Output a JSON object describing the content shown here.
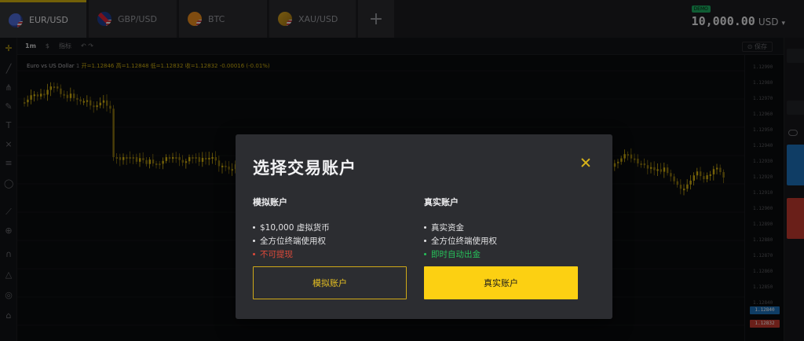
{
  "tabs": [
    {
      "label": "EUR/USD",
      "icon": "eur-usd-flag-icon",
      "active": true
    },
    {
      "label": "GBP/USD",
      "icon": "gbp-usd-flag-icon",
      "active": false
    },
    {
      "label": "BTC",
      "icon": "btc-icon",
      "active": false
    },
    {
      "label": "XAU/USD",
      "icon": "gold-icon",
      "active": false
    }
  ],
  "add_tab_label": "+",
  "account": {
    "badge": "DEMO",
    "amount": "10,000.00",
    "currency": "USD",
    "caret": "▾"
  },
  "toolbar": {
    "timeframe": "1m",
    "chart_type": "$",
    "indicators": "指标",
    "undo": "↶ ↷",
    "right_btn": "⊙ 保存"
  },
  "ohlc": {
    "pair": "Euro vs US Dollar",
    "interval": "1",
    "values": "开=1.12846 高=1.12848 低=1.12832 收=1.12832 -0.00016 (-0.01%)"
  },
  "price_axis": {
    "ticks": [
      "1.12990",
      "1.12980",
      "1.12970",
      "1.12960",
      "1.12950",
      "1.12940",
      "1.12930",
      "1.12920",
      "1.12910",
      "1.12900",
      "1.12890",
      "1.12880",
      "1.12870",
      "1.12860",
      "1.12850",
      "1.12840"
    ],
    "tag_blue": "1.12840",
    "tag_red": "1.12832",
    "colors": {
      "up": "#d5b30f",
      "down": "#8a7410",
      "blue": "#1d6fb8",
      "red": "#c23a2e"
    }
  },
  "modal": {
    "title": "选择交易账户",
    "demo": {
      "heading": "模拟账户",
      "features": [
        "$10,000 虚拟货币",
        "全方位终端使用权",
        "不可提现"
      ],
      "button": "模拟账户"
    },
    "real": {
      "heading": "真实账户",
      "features": [
        "真实资金",
        "全方位终端使用权",
        "即时自动出金"
      ],
      "button": "真实账户"
    },
    "colors": {
      "accent": "#fcd012",
      "negative": "#e04a3a",
      "positive": "#26c15a"
    }
  }
}
